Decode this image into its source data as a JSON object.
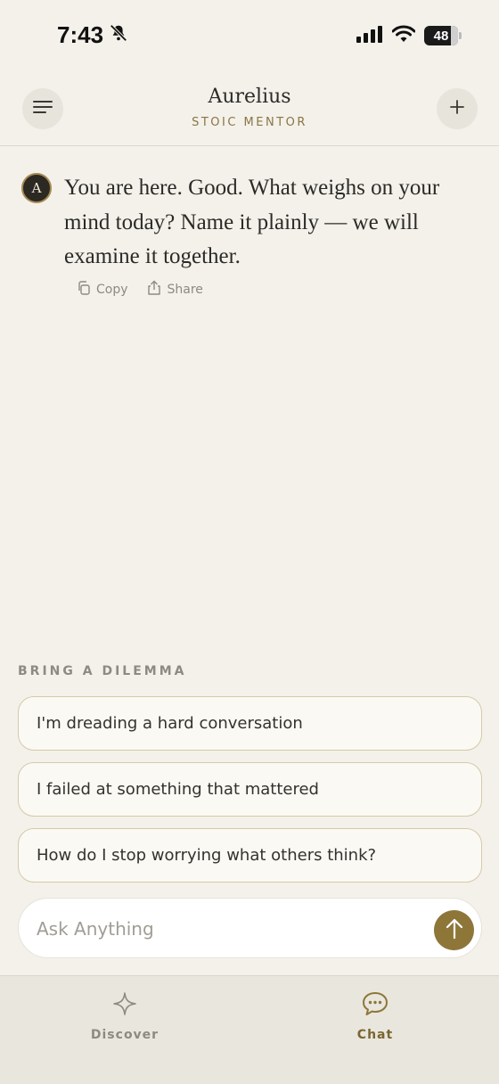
{
  "status": {
    "time": "7:43",
    "battery": "48",
    "battery_level": 0.48
  },
  "header": {
    "title": "Aurelius",
    "subtitle": "STOIC MENTOR"
  },
  "message": {
    "avatar": "A",
    "text": "You are here. Good. What weighs on your mind today? Name it plainly — we will examine it together.",
    "copy_label": "Copy",
    "share_label": "Share"
  },
  "suggestions": {
    "label": "BRING A DILEMMA",
    "items": [
      "I'm dreading a hard conversation",
      "I failed at something that mattered",
      "How do I stop worrying what others think?"
    ]
  },
  "composer": {
    "placeholder": "Ask Anything"
  },
  "tabs": [
    {
      "label": "Discover",
      "icon": "sparkle-icon"
    },
    {
      "label": "Chat",
      "icon": "chat-bubble-icon"
    }
  ],
  "colors": {
    "background": "#f3f1ea",
    "accent": "#8e7639",
    "subtitle": "#8a7545"
  }
}
